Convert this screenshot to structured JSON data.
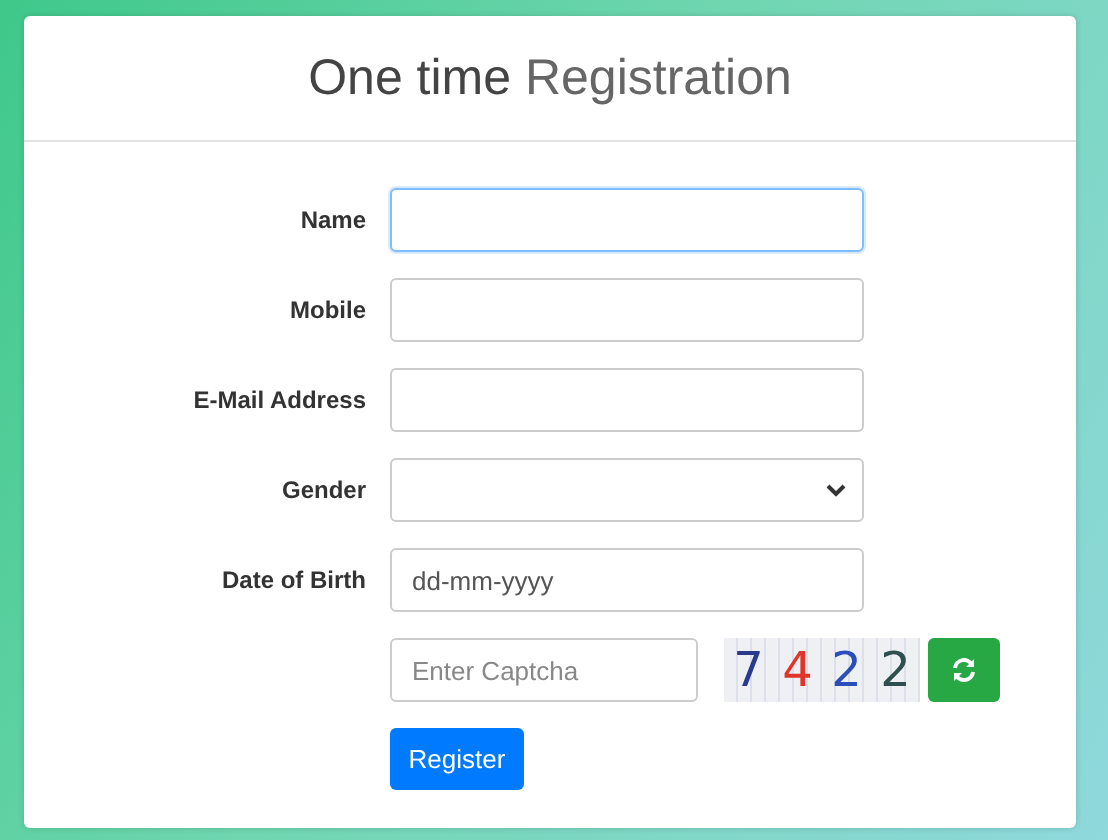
{
  "title": "**One time** Registration",
  "fields": [
    {
      "label": "Name",
      "kind": "text",
      "focused": true
    },
    {
      "label": "Mobile",
      "kind": "text",
      "focused": false
    },
    {
      "label": "E-Mail Address",
      "kind": "text",
      "focused": false
    },
    {
      "label": "Gender",
      "kind": "select"
    },
    {
      "label": "Date of Birth",
      "kind": "text",
      "placeholder": "dd-mm-yyyy",
      "focused": false
    }
  ],
  "captcha": {
    "placeholder": "Enter Captcha",
    "characters": [
      {
        "char": "7",
        "color": "#2a3a8c"
      },
      {
        "char": "4",
        "color": "#e0352b"
      },
      {
        "char": "2",
        "color": "#2a4fb8"
      },
      {
        "char": "2",
        "color": "#2f4f4f"
      }
    ]
  },
  "submit": "Register"
}
